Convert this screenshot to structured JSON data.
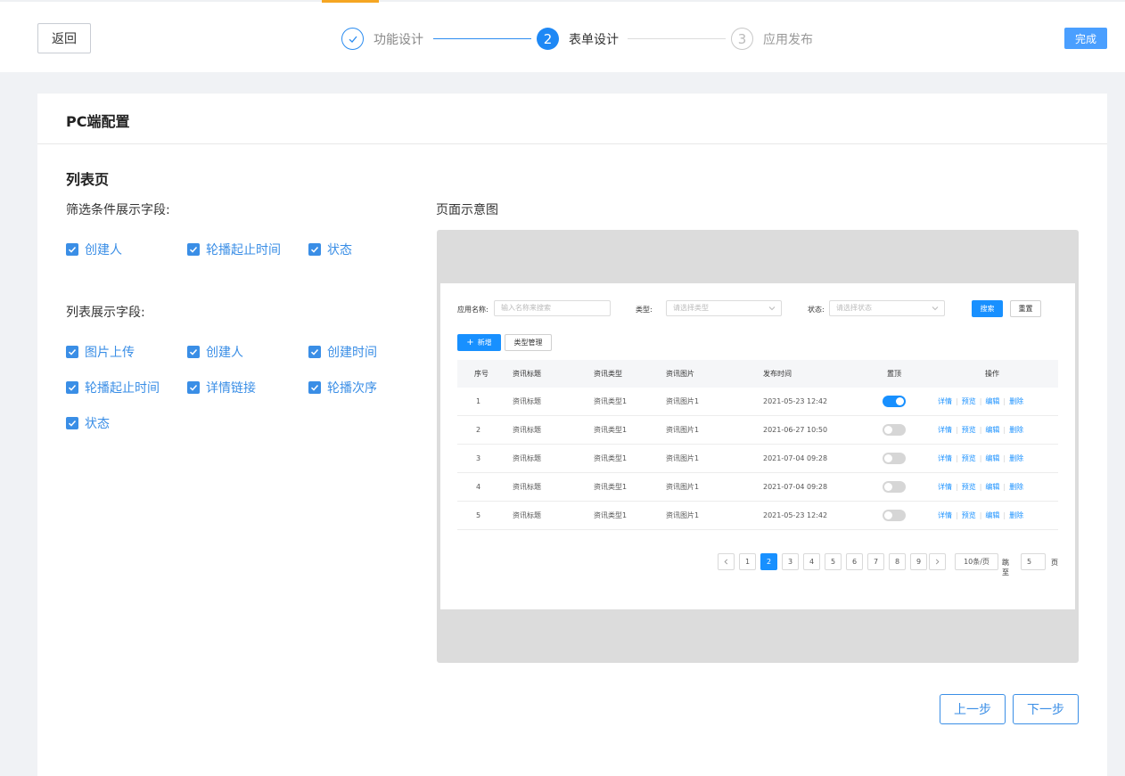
{
  "header": {
    "back_label": "返回",
    "done_label": "完成",
    "steps": [
      {
        "number": "✓",
        "label": "功能设计"
      },
      {
        "number": "2",
        "label": "表单设计"
      },
      {
        "number": "3",
        "label": "应用发布"
      }
    ]
  },
  "card": {
    "title": "PC端配置",
    "section_title": "列表页",
    "filter_label": "筛选条件展示字段:",
    "filter_fields": [
      "创建人",
      "轮播起止时间",
      "状态"
    ],
    "list_label": "列表展示字段:",
    "list_fields": [
      "图片上传",
      "创建人",
      "创建时间",
      "轮播起止时间",
      "详情链接",
      "轮播次序",
      "状态"
    ],
    "preview_label": "页面示意图",
    "prev_label": "上一步",
    "next_label": "下一步"
  },
  "preview": {
    "search": {
      "name_label": "应用名称:",
      "name_placeholder": "输入名称来搜索",
      "type_label": "类型:",
      "type_placeholder": "请选择类型",
      "status_label": "状态:",
      "status_placeholder": "请选择状态",
      "search_btn": "搜索",
      "reset_btn": "重置"
    },
    "add_btn": "新增",
    "type_manage_btn": "类型管理",
    "columns": [
      "序号",
      "资讯标题",
      "资讯类型",
      "资讯图片",
      "发布时间",
      "置顶",
      "操作"
    ],
    "rows": [
      {
        "no": "1",
        "title": "资讯标题",
        "type": "资讯类型1",
        "image": "资讯图片1",
        "time": "2021-05-23 12:42",
        "top": true
      },
      {
        "no": "2",
        "title": "资讯标题",
        "type": "资讯类型1",
        "image": "资讯图片1",
        "time": "2021-06-27 10:50",
        "top": false
      },
      {
        "no": "3",
        "title": "资讯标题",
        "type": "资讯类型1",
        "image": "资讯图片1",
        "time": "2021-07-04 09:28",
        "top": false
      },
      {
        "no": "4",
        "title": "资讯标题",
        "type": "资讯类型1",
        "image": "资讯图片1",
        "time": "2021-07-04 09:28",
        "top": false
      },
      {
        "no": "5",
        "title": "资讯标题",
        "type": "资讯类型1",
        "image": "资讯图片1",
        "time": "2021-05-23 12:42",
        "top": false
      }
    ],
    "actions": [
      "详情",
      "预览",
      "编辑",
      "删除"
    ],
    "pagination": {
      "pages": [
        "1",
        "2",
        "3",
        "4",
        "5",
        "6",
        "7",
        "8",
        "9"
      ],
      "current": "2",
      "page_size": "10条/页",
      "jump_label": "跳至",
      "jump_value": "5",
      "page_suffix": "页"
    }
  }
}
